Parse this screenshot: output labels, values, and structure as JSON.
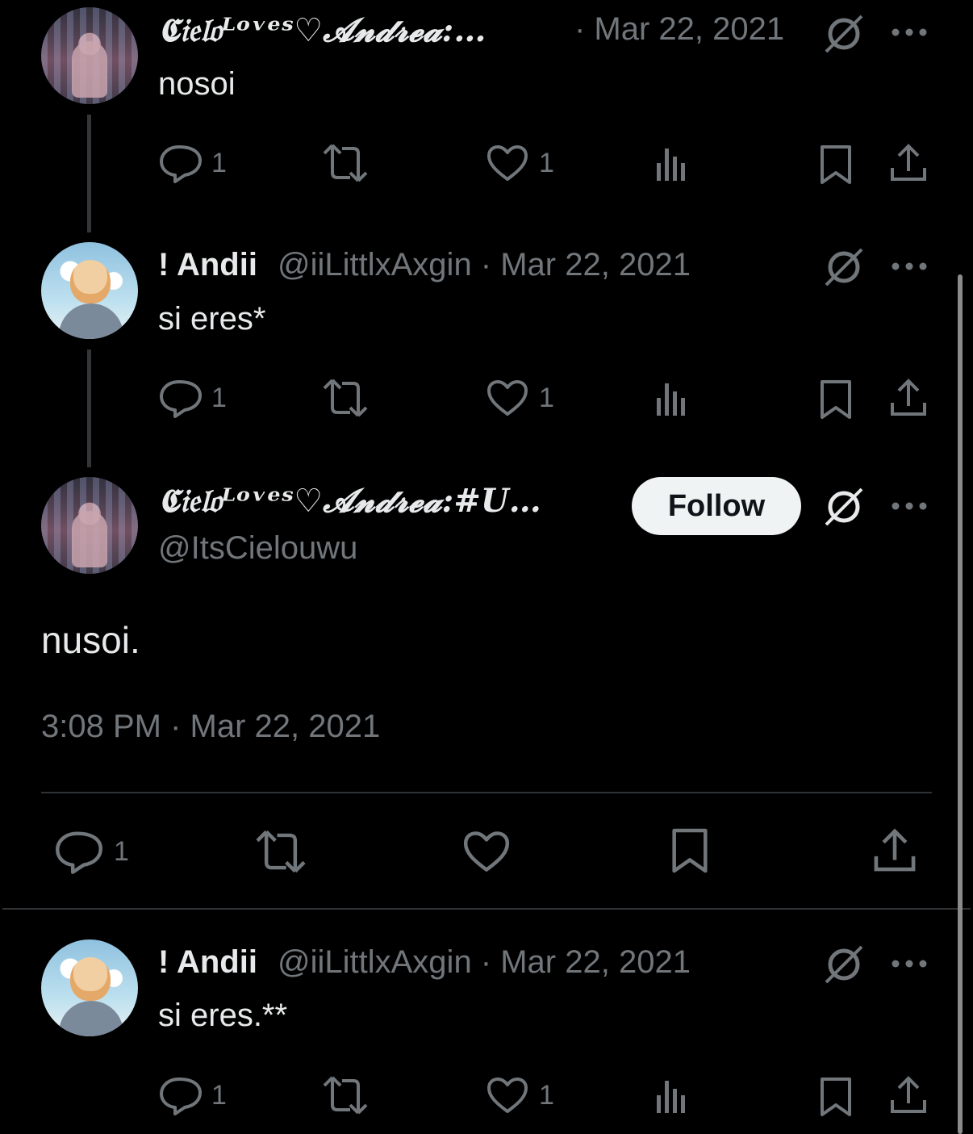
{
  "tweets": [
    {
      "author_name": "𝕮𝔦𝔢𝔩𝔬ᴸᵒᵛᵉˢ♡𝓐𝓷𝓭𝓻𝓮𝓪:…",
      "meta": "· Mar 22, 2021",
      "text": "nosoi",
      "reply_count": "1",
      "like_count": "1"
    },
    {
      "author_name": "! Andii",
      "meta": "@iiLittlxAxgin · Mar 22, 2021",
      "text": "si eres*",
      "reply_count": "1",
      "like_count": "1"
    }
  ],
  "main_tweet": {
    "author_name": "𝕮𝔦𝔢𝔩𝔬ᴸᵒᵛᵉˢ♡𝓐𝓷𝓭𝓻𝓮𝓪:#U…",
    "handle": "@ItsCielouwu",
    "follow_label": "Follow",
    "text": "nusoi.",
    "timestamp": "3:08 PM · Mar 22, 2021",
    "reply_count": "1"
  },
  "reply": {
    "author_name": "! Andii",
    "meta": "@iiLittlxAxgin · Mar 22, 2021",
    "text": "si eres.**",
    "reply_count": "1",
    "like_count": "1"
  },
  "colors": {
    "background": "#000000",
    "text": "#e7e9ea",
    "muted": "#71767b",
    "divider": "#2f3336"
  }
}
